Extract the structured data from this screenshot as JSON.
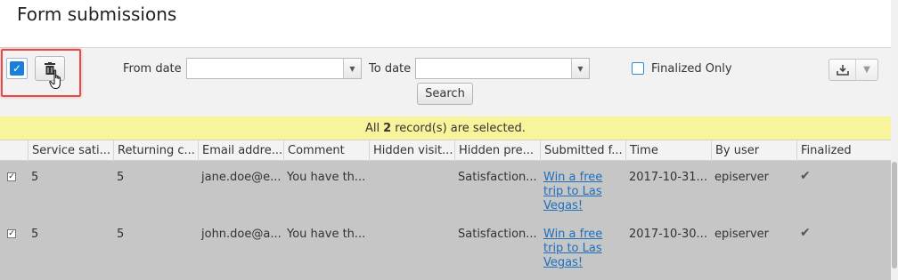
{
  "page": {
    "title": "Form submissions"
  },
  "toolbar": {
    "from_date_label": "From date",
    "from_date_value": "",
    "to_date_label": "To date",
    "to_date_value": "",
    "search_label": "Search",
    "finalized_only_label": "Finalized Only",
    "finalized_only_checked": false,
    "select_all_checked": true
  },
  "selection": {
    "prefix": "All",
    "count": "2",
    "suffix": "record(s) are selected."
  },
  "grid": {
    "columns": [
      "Service sati...",
      "Returning c...",
      "Email addre...",
      "Comment",
      "Hidden visit...",
      "Hidden pre...",
      "Submitted f...",
      "Time",
      "By user",
      "Finalized"
    ],
    "rows": [
      {
        "checked": true,
        "service": "5",
        "returning": "5",
        "email": "jane.doe@e...",
        "comment": "You have th...",
        "hidden_visit": "",
        "hidden_pre": "Satisfaction...",
        "submitted": "Win a free trip to Las Vegas!",
        "time": "2017-10-31...",
        "user": "episerver",
        "finalized": "✔"
      },
      {
        "checked": true,
        "service": "5",
        "returning": "5",
        "email": "john.doe@a...",
        "comment": "You have th...",
        "hidden_visit": "",
        "hidden_pre": "Satisfaction...",
        "submitted": "Win a free trip to Las Vegas!",
        "time": "2017-10-30...",
        "user": "episerver",
        "finalized": "✔"
      }
    ]
  },
  "icons": {
    "select_all": "checkbox-icon",
    "delete": "trash-icon",
    "cursor": "hand-pointer-icon",
    "date_dropdown": "triangle-down-icon",
    "export": "download-icon",
    "export_menu": "chevron-down-icon",
    "finalized": "checkmark-icon"
  },
  "colors": {
    "selection_bar": "#f8f49b",
    "highlight": "#e44b4b",
    "accent": "#1a7fd8",
    "row_bg": "#c6c6c6",
    "link": "#1b6fbf"
  }
}
